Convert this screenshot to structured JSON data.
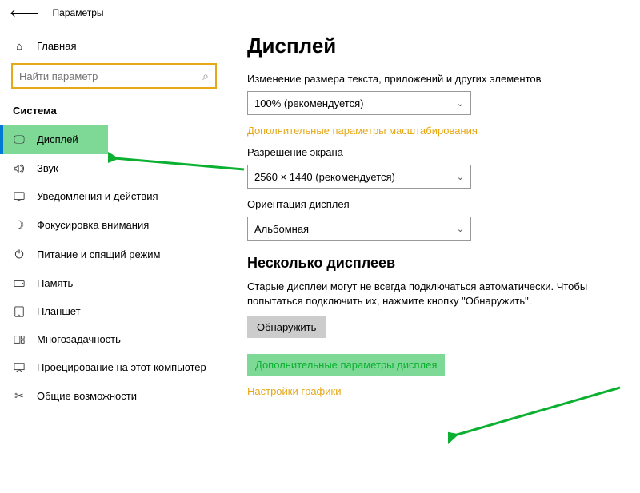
{
  "header": {
    "app_title": "Параметры"
  },
  "sidebar": {
    "home_label": "Главная",
    "search_placeholder": "Найти параметр",
    "category": "Система",
    "items": [
      {
        "label": "Дисплей"
      },
      {
        "label": "Звук"
      },
      {
        "label": "Уведомления и действия"
      },
      {
        "label": "Фокусировка внимания"
      },
      {
        "label": "Питание и спящий режим"
      },
      {
        "label": "Память"
      },
      {
        "label": "Планшет"
      },
      {
        "label": "Многозадачность"
      },
      {
        "label": "Проецирование на этот компьютер"
      },
      {
        "label": "Общие возможности"
      }
    ]
  },
  "content": {
    "title": "Дисплей",
    "scale_label": "Изменение размера текста, приложений и других элементов",
    "scale_value": "100% (рекомендуется)",
    "scale_link": "Дополнительные параметры масштабирования",
    "resolution_label": "Разрешение экрана",
    "resolution_value": "2560 × 1440 (рекомендуется)",
    "orientation_label": "Ориентация дисплея",
    "orientation_value": "Альбомная",
    "multi_title": "Несколько дисплеев",
    "multi_desc": "Старые дисплеи могут не всегда подключаться автоматически. Чтобы попытаться подключить их, нажмите кнопку \"Обнаружить\".",
    "detect_btn": "Обнаружить",
    "adv_display_link": "Дополнительные параметры дисплея",
    "graphics_link": "Настройки графики"
  }
}
